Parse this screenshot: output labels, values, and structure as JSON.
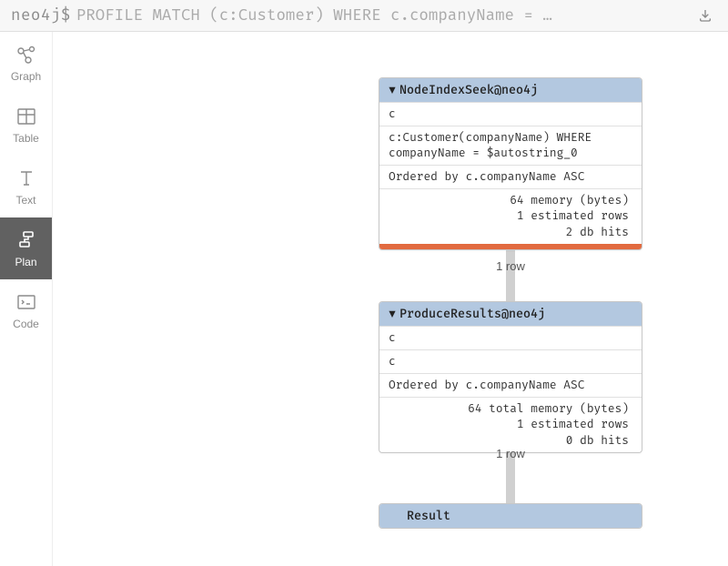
{
  "query_bar": {
    "prompt": "neo4j$",
    "query": "PROFILE MATCH (c:Customer) WHERE c.companyName = …"
  },
  "sidebar": {
    "items": [
      {
        "label": "Graph",
        "active": false
      },
      {
        "label": "Table",
        "active": false
      },
      {
        "label": "Text",
        "active": false
      },
      {
        "label": "Plan",
        "active": true
      },
      {
        "label": "Code",
        "active": false
      }
    ]
  },
  "plan": {
    "node1": {
      "title": "NodeIndexSeek@neo4j",
      "vars": "c",
      "detail": "c:Customer(companyName) WHERE companyName = $autostring_0",
      "order": "Ordered by c.companyName ASC",
      "stat1": "64 memory (bytes)",
      "stat2": "1 estimated rows",
      "stat3": "2 db hits",
      "rows": "1 row"
    },
    "node2": {
      "title": "ProduceResults@neo4j",
      "vars1": "c",
      "vars2": "c",
      "order": "Ordered by c.companyName ASC",
      "stat1": "64 total memory (bytes)",
      "stat2": "1 estimated rows",
      "stat3": "0 db hits",
      "rows": "1 row"
    },
    "result": {
      "title": "Result"
    }
  }
}
